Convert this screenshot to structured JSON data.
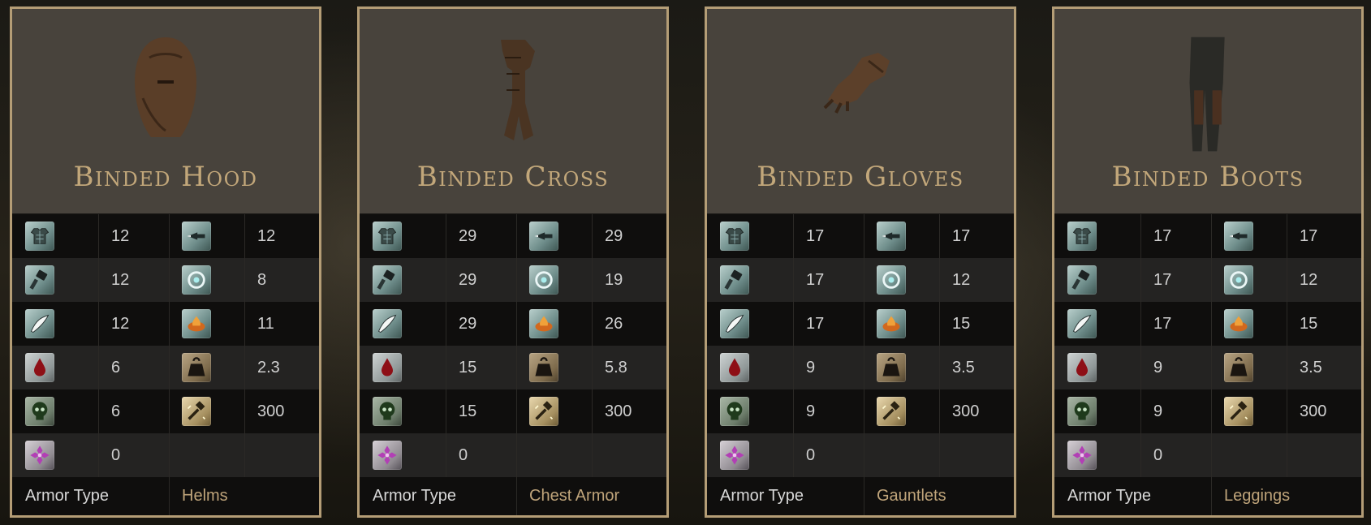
{
  "colors": {
    "border": "#b49d76",
    "title": "#c2a77a",
    "armor_type_value": "#bfa47a",
    "header_bg": "#48433c"
  },
  "stat_icons": {
    "physical": "chest-armor-icon",
    "strike": "gauntlet-strike-icon",
    "slash": "blade-slash-icon",
    "pierce": "pierce-arrow-icon",
    "magic": "magic-swirl-icon",
    "fire": "fire-icon",
    "bleed": "blood-drop-icon",
    "weight": "weight-icon",
    "poison": "poison-skull-icon",
    "durability": "durability-hammer-icon",
    "frost": "frost-cross-icon"
  },
  "cards": [
    {
      "title": "Binded Hood",
      "image": "hood-icon",
      "physical": "12",
      "pierce": "12",
      "strike": "12",
      "magic": "8",
      "slash": "12",
      "fire": "11",
      "bleed": "6",
      "weight": "2.3",
      "poison": "6",
      "durability": "300",
      "frost": "0",
      "armor_type_label": "Armor Type",
      "armor_type": "Helms"
    },
    {
      "title": "Binded Cross",
      "image": "chest-armor-image-icon",
      "physical": "29",
      "pierce": "29",
      "strike": "29",
      "magic": "19",
      "slash": "29",
      "fire": "26",
      "bleed": "15",
      "weight": "5.8",
      "poison": "15",
      "durability": "300",
      "frost": "0",
      "armor_type_label": "Armor Type",
      "armor_type": "Chest Armor"
    },
    {
      "title": "Binded Gloves",
      "image": "gloves-icon",
      "physical": "17",
      "pierce": "17",
      "strike": "17",
      "magic": "12",
      "slash": "17",
      "fire": "15",
      "bleed": "9",
      "weight": "3.5",
      "poison": "9",
      "durability": "300",
      "frost": "0",
      "armor_type_label": "Armor Type",
      "armor_type": "Gauntlets"
    },
    {
      "title": "Binded Boots",
      "image": "leggings-icon",
      "physical": "17",
      "pierce": "17",
      "strike": "17",
      "magic": "12",
      "slash": "17",
      "fire": "15",
      "bleed": "9",
      "weight": "3.5",
      "poison": "9",
      "durability": "300",
      "frost": "0",
      "armor_type_label": "Armor Type",
      "armor_type": "Leggings"
    }
  ]
}
